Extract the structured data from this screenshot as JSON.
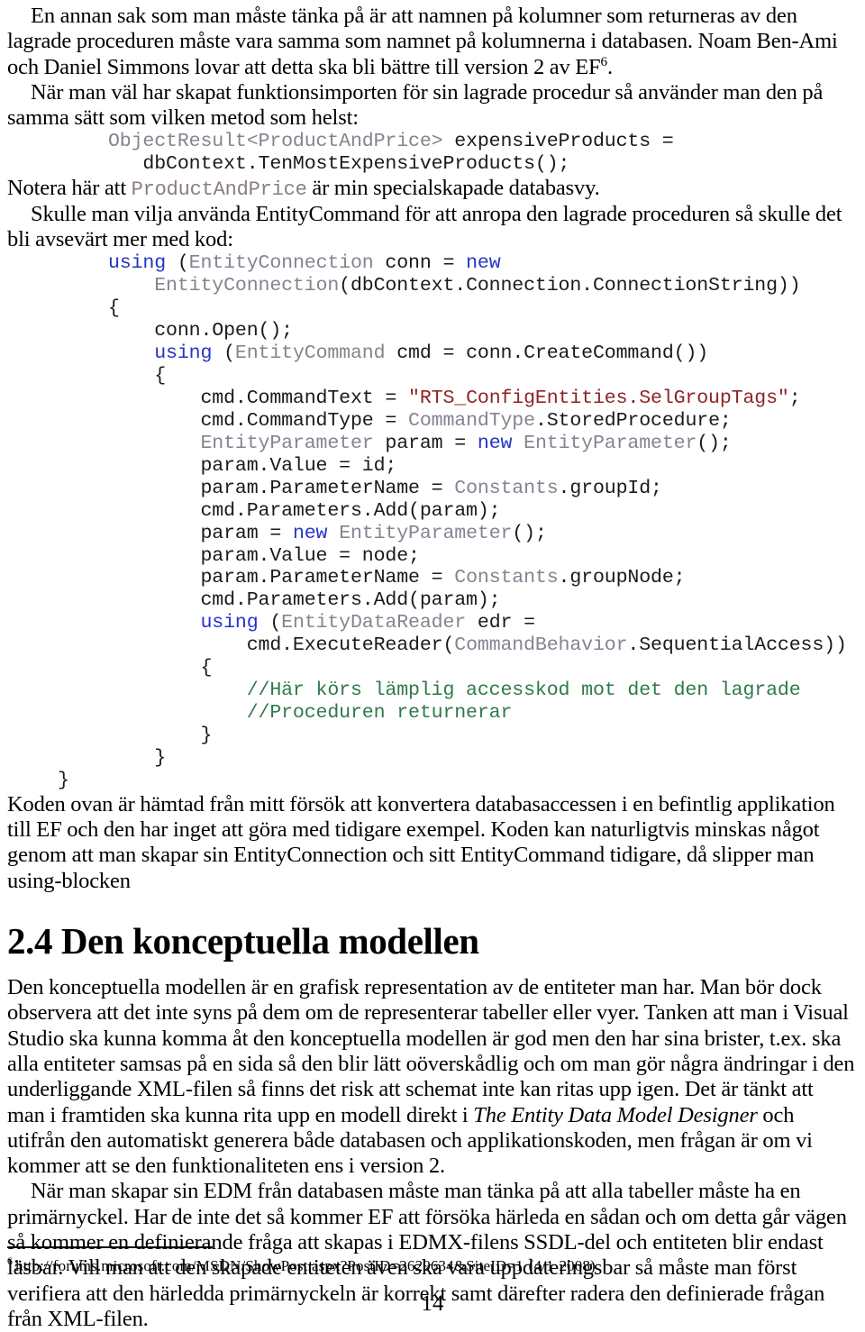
{
  "document": {
    "language": "sv",
    "page_number": "14"
  },
  "paragraphs": {
    "p1": "En annan sak som man måste tänka på är att namnen på kolumner som returneras av den lagrade proceduren måste vara samma som namnet på kolumnerna i databasen. Noam Ben-Ami och Daniel Simmons lovar att detta ska bli bättre till version 2 av EF",
    "p1_footnote_marker": "6",
    "p1_tail": ".",
    "p2": "När man väl har skapat funktionsimporten för sin lagrade procedur så använder man den på samma sätt som vilken metod som helst:",
    "p3_before_code": "Notera här att ",
    "p3_code": "ProductAndPrice",
    "p3_after_code": " är min specialskapade databasvy.",
    "p4": "Skulle man vilja använda EntityCommand för att anropa den lagrade proceduren så skulle det bli avsevärt mer med kod:",
    "p5": "Koden ovan är hämtad från mitt försök att konvertera databasaccessen i en befintlig applikation till EF och den har inget att göra med tidigare exempel. Koden kan naturligtvis minskas något genom att man skapar sin EntityConnection och sitt EntityCommand tidigare, då slipper man using-blocken",
    "p6": "Den konceptuella modellen är en grafisk representation av de entiteter man har. Man bör dock observera att det inte syns på dem om de representerar tabeller eller vyer. Tanken att man i Visual Studio ska kunna komma åt den konceptuella modellen är god men den har sina brister, t.ex. ska alla entiteter samsas på en sida så den blir lätt oöverskådlig och om man gör några ändringar i den underliggande XML-filen så finns det risk att schemat inte kan ritas upp igen. Det är tänkt att man i framtiden ska kunna rita upp en modell direkt i ",
    "p6_italic": "The Entity Data Model Designer",
    "p6_tail": " och utifrån den automatiskt generera både databasen och applikationskoden, men frågan är om vi kommer att se den funktionaliteten ens i version 2.",
    "p7": "När man skapar sin EDM från databasen måste man tänka på att alla tabeller måste ha en primärnyckel. Har de inte det så kommer EF att försöka härleda en sådan och om detta går vägen så kommer en definierande fråga att skapas i EDMX-filens SSDL-del och entiteten blir endast läsbar. Vill man att den skapade entiteten även ska vara uppdateringsbar så måste man först verifiera att den härledda primärnyckeln är korrekt samt därefter radera den definierade frågan från XML-filen."
  },
  "heading": {
    "section_number": "2.4",
    "section_title": "Den konceptuella modellen",
    "full": "2.4 Den konceptuella modellen"
  },
  "code_block_1": {
    "lines": [
      [
        {
          "t": "ObjectResult<ProductAndPrice>",
          "c": "cb-type"
        },
        {
          "t": " expensiveProducts =",
          "c": "cb-plain"
        }
      ],
      [
        {
          "t": "   dbContext.TenMostExpensiveProducts();",
          "c": "cb-plain"
        }
      ]
    ]
  },
  "code_block_2": {
    "lines": [
      [
        {
          "t": "using",
          "c": "cb-kw"
        },
        {
          "t": " (",
          "c": "cb-plain"
        },
        {
          "t": "EntityConnection",
          "c": "cb-type"
        },
        {
          "t": " conn = ",
          "c": "cb-plain"
        },
        {
          "t": "new",
          "c": "cb-kw"
        }
      ],
      [
        {
          "t": "    ",
          "c": "cb-plain"
        },
        {
          "t": "EntityConnection",
          "c": "cb-type"
        },
        {
          "t": "(dbContext.Connection.ConnectionString))",
          "c": "cb-plain"
        }
      ],
      [
        {
          "t": "{",
          "c": "cb-plain"
        }
      ],
      [
        {
          "t": "    conn.Open();",
          "c": "cb-plain"
        }
      ],
      [
        {
          "t": "    ",
          "c": "cb-plain"
        },
        {
          "t": "using",
          "c": "cb-kw"
        },
        {
          "t": " (",
          "c": "cb-plain"
        },
        {
          "t": "EntityCommand",
          "c": "cb-type"
        },
        {
          "t": " cmd = conn.CreateCommand())",
          "c": "cb-plain"
        }
      ],
      [
        {
          "t": "    {",
          "c": "cb-plain"
        }
      ],
      [
        {
          "t": "        cmd.CommandText = ",
          "c": "cb-plain"
        },
        {
          "t": "\"RTS_ConfigEntities.SelGroupTags\"",
          "c": "cb-str"
        },
        {
          "t": ";",
          "c": "cb-plain"
        }
      ],
      [
        {
          "t": "        cmd.CommandType = ",
          "c": "cb-plain"
        },
        {
          "t": "CommandType",
          "c": "cb-type"
        },
        {
          "t": ".StoredProcedure;",
          "c": "cb-plain"
        }
      ],
      [
        {
          "t": "        ",
          "c": "cb-plain"
        },
        {
          "t": "EntityParameter",
          "c": "cb-type"
        },
        {
          "t": " param = ",
          "c": "cb-plain"
        },
        {
          "t": "new",
          "c": "cb-kw"
        },
        {
          "t": " ",
          "c": "cb-plain"
        },
        {
          "t": "EntityParameter",
          "c": "cb-type"
        },
        {
          "t": "();",
          "c": "cb-plain"
        }
      ],
      [
        {
          "t": "        param.Value = id;",
          "c": "cb-plain"
        }
      ],
      [
        {
          "t": "        param.ParameterName = ",
          "c": "cb-plain"
        },
        {
          "t": "Constants",
          "c": "cb-type"
        },
        {
          "t": ".groupId;",
          "c": "cb-plain"
        }
      ],
      [
        {
          "t": "        cmd.Parameters.Add(param);",
          "c": "cb-plain"
        }
      ],
      [
        {
          "t": "        param = ",
          "c": "cb-plain"
        },
        {
          "t": "new",
          "c": "cb-kw"
        },
        {
          "t": " ",
          "c": "cb-plain"
        },
        {
          "t": "EntityParameter",
          "c": "cb-type"
        },
        {
          "t": "();",
          "c": "cb-plain"
        }
      ],
      [
        {
          "t": "        param.Value = node;",
          "c": "cb-plain"
        }
      ],
      [
        {
          "t": "        param.ParameterName = ",
          "c": "cb-plain"
        },
        {
          "t": "Constants",
          "c": "cb-type"
        },
        {
          "t": ".groupNode;",
          "c": "cb-plain"
        }
      ],
      [
        {
          "t": "        cmd.Parameters.Add(param);",
          "c": "cb-plain"
        }
      ],
      [
        {
          "t": "        ",
          "c": "cb-plain"
        },
        {
          "t": "using",
          "c": "cb-kw"
        },
        {
          "t": " (",
          "c": "cb-plain"
        },
        {
          "t": "EntityDataReader",
          "c": "cb-type"
        },
        {
          "t": " edr =",
          "c": "cb-plain"
        }
      ],
      [
        {
          "t": "            cmd.ExecuteReader(",
          "c": "cb-plain"
        },
        {
          "t": "CommandBehavior",
          "c": "cb-type"
        },
        {
          "t": ".SequentialAccess))",
          "c": "cb-plain"
        }
      ],
      [
        {
          "t": "        {",
          "c": "cb-plain"
        }
      ],
      [
        {
          "t": "            ",
          "c": "cb-plain"
        },
        {
          "t": "//Här körs lämplig accesskod mot det den lagrade",
          "c": "cb-comment"
        }
      ],
      [
        {
          "t": "            ",
          "c": "cb-plain"
        },
        {
          "t": "//Proceduren returnerar",
          "c": "cb-comment"
        }
      ],
      [
        {
          "t": "        }",
          "c": "cb-plain"
        }
      ],
      [
        {
          "t": "    }",
          "c": "cb-plain"
        }
      ]
    ]
  },
  "footnote": {
    "marker": "6",
    "text": "http://forums.microsoft.com/MSDN/ShowPost.aspx?PostID=2629634&SiteID=1 (4/1 2008)"
  },
  "colors": {
    "keyword": "#2433c8",
    "type": "#8a8190",
    "string": "#8e2424",
    "comment": "#2f7a4a",
    "text": "#000000",
    "background": "#ffffff"
  }
}
